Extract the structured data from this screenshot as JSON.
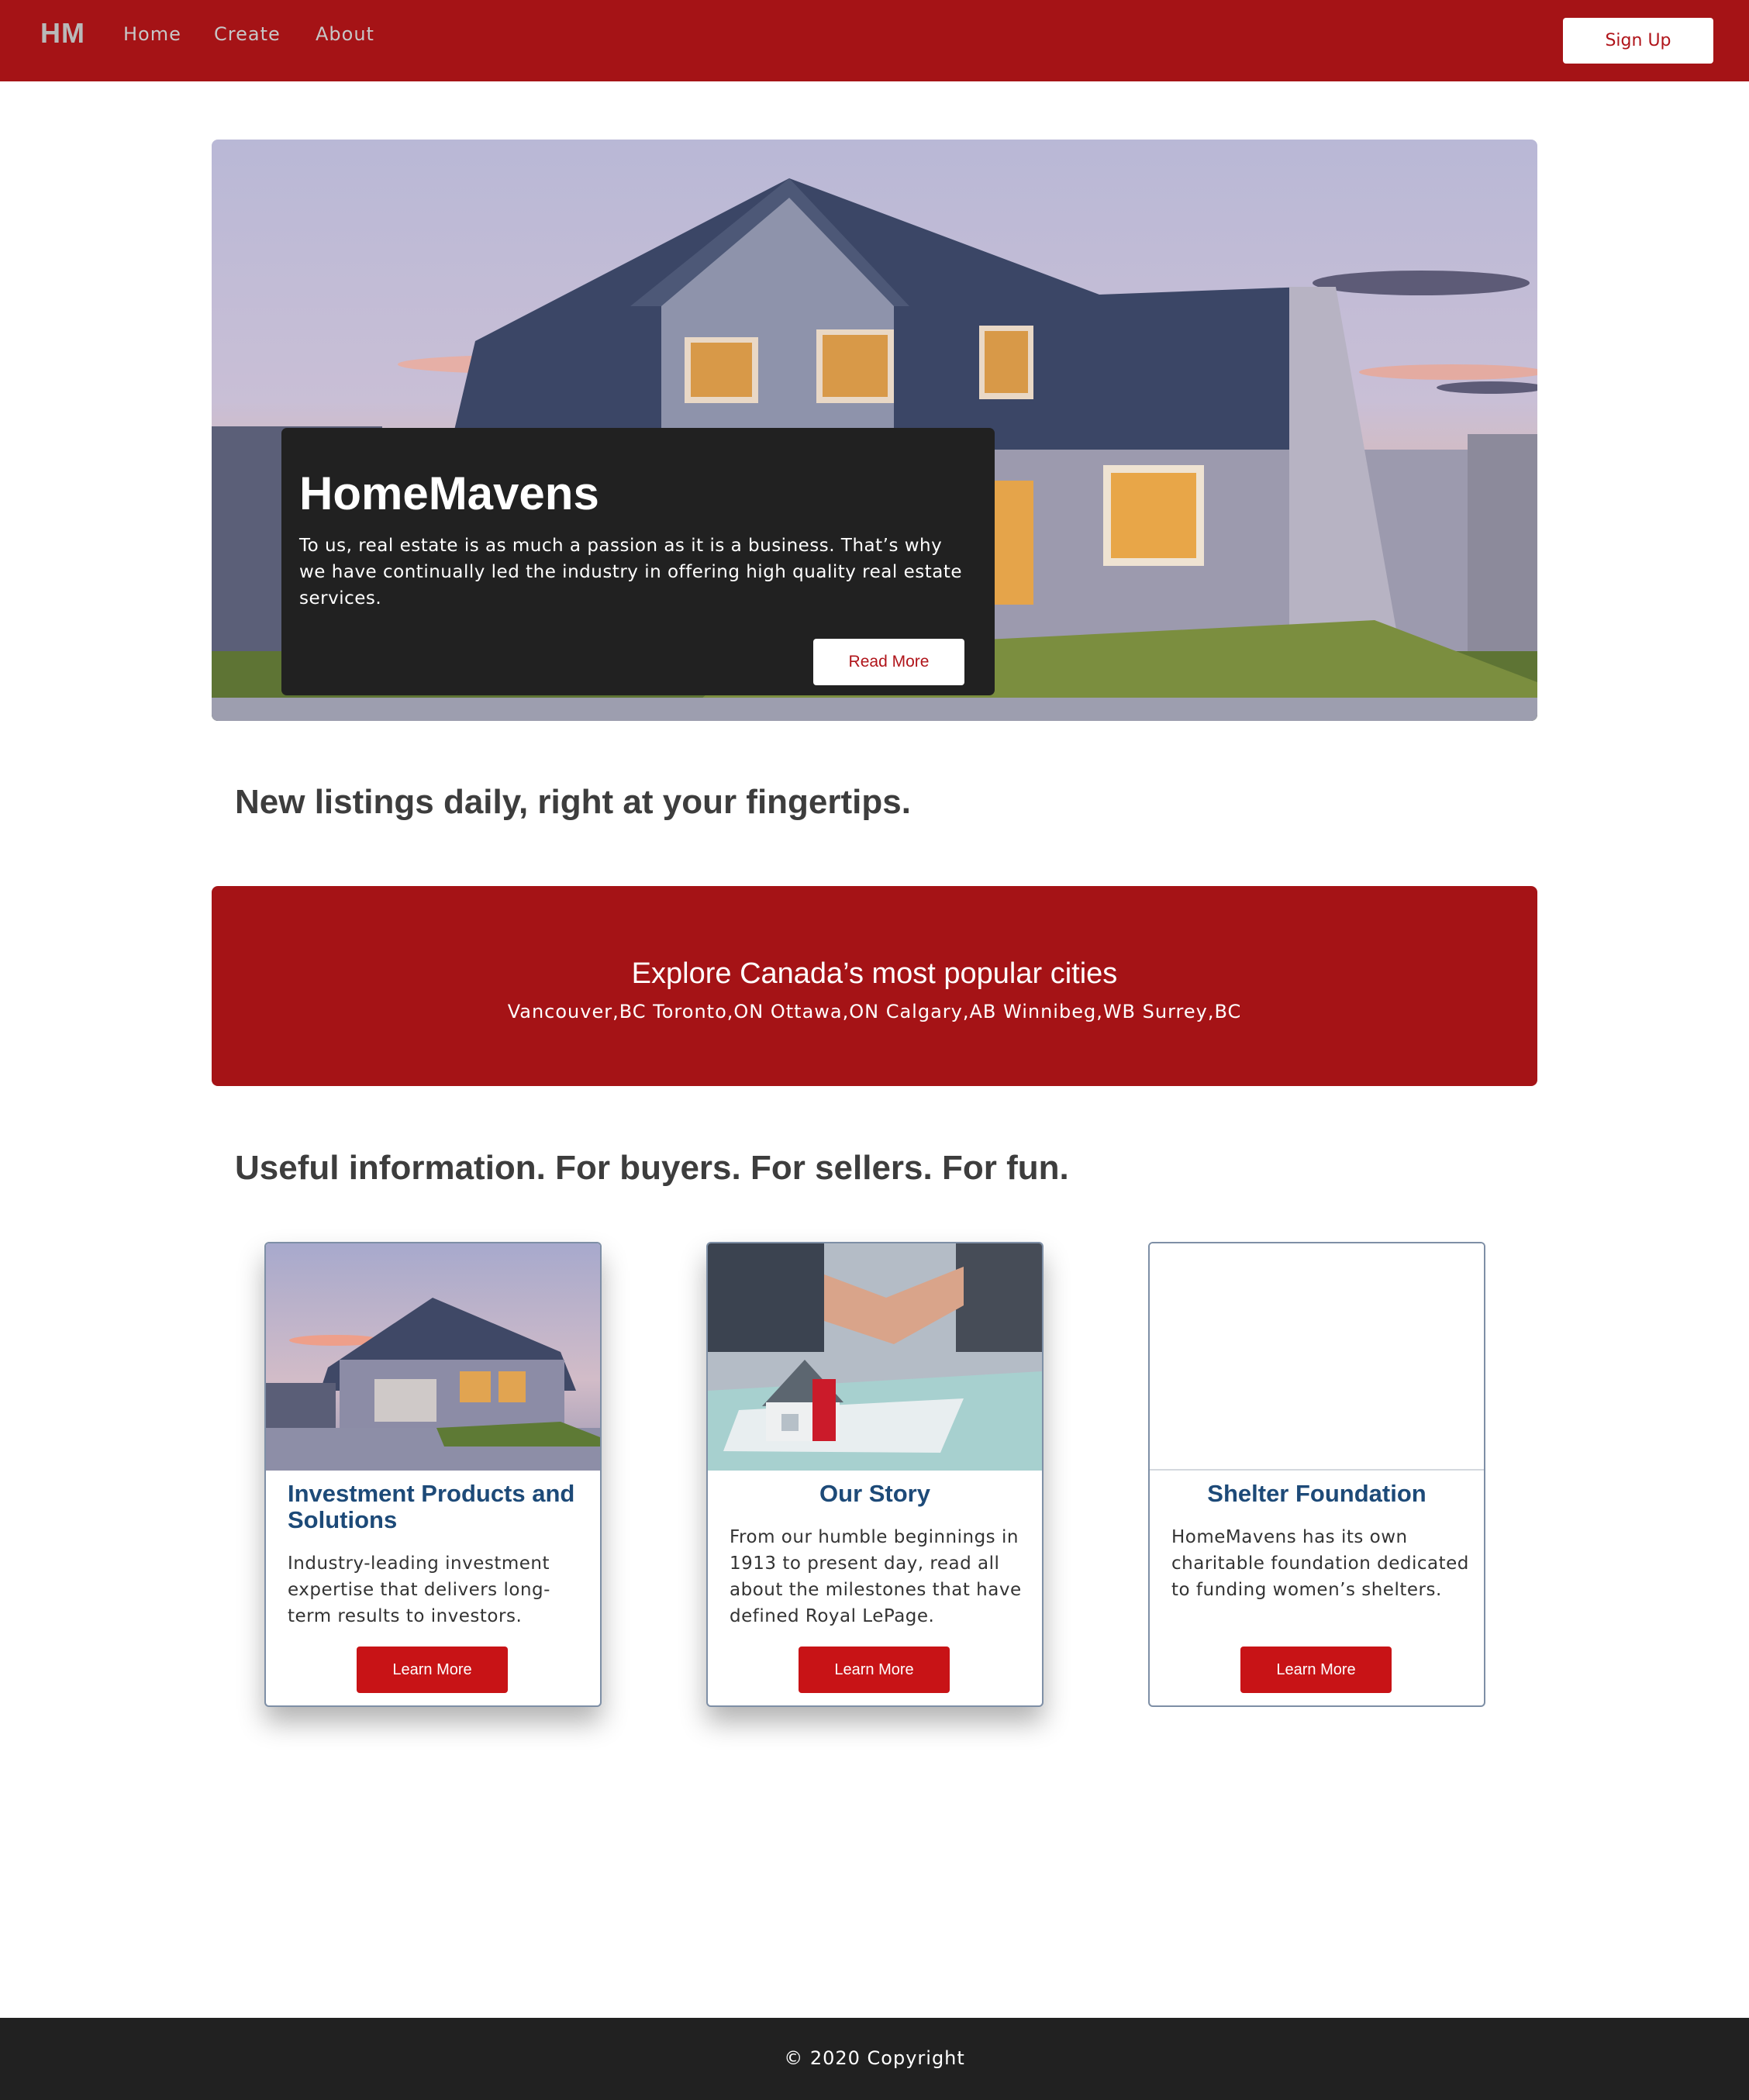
{
  "header": {
    "brand": "HM",
    "nav": [
      "Home",
      "Create",
      "About"
    ],
    "signup_label": "Sign Up"
  },
  "hero": {
    "title": "HomeMavens",
    "text": "To us, real estate is as much a passion as it is a business. That’s why we have continually led the industry in offering high quality real estate services.",
    "button": "Read More"
  },
  "listings_heading": "New listings daily, right at your fingertips.",
  "banner": {
    "title": "Explore Canada’s most popular cities",
    "cities": "Vancouver,BC Toronto,ON Ottawa,ON Calgary,AB Winnibeg,WB Surrey,BC"
  },
  "info_heading": "Useful information. For buyers. For sellers. For fun.",
  "cards": [
    {
      "title": "Investment Products and Solutions",
      "text": "Industry-leading investment expertise that delivers long-term results to investors.",
      "button": "Learn More"
    },
    {
      "title": "Our Story",
      "text": "From our humble beginnings in 1913 to present day, read all about the milestones that have defined Royal LePage.",
      "button": "Learn More"
    },
    {
      "title": "Shelter Foundation",
      "text": "HomeMavens has its own charitable foundation dedicated to funding women’s shelters.",
      "button": "Learn More"
    }
  ],
  "footer": {
    "copyright": "© 2020 Copyright"
  },
  "colors": {
    "brand_red": "#a51316",
    "button_red": "#c81316",
    "dark": "#212121",
    "card_title_blue": "#1d4a78"
  }
}
